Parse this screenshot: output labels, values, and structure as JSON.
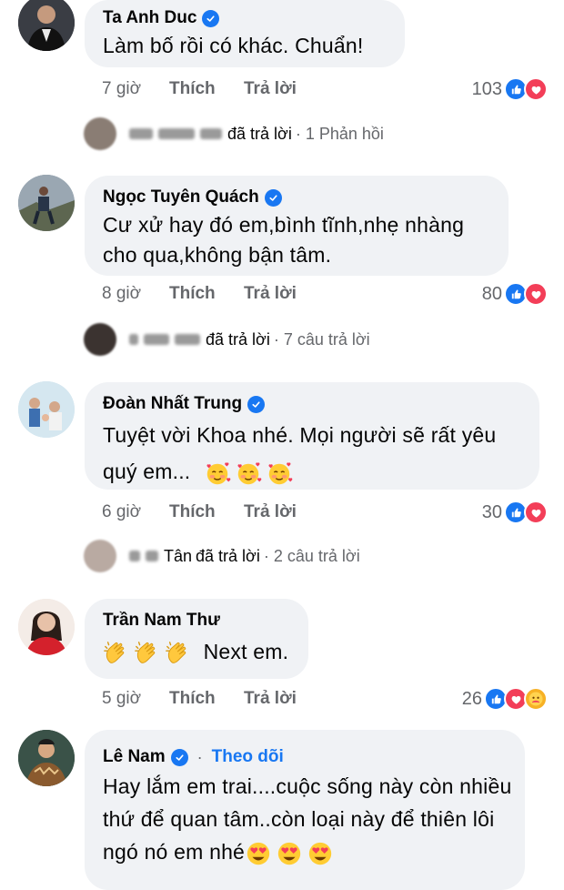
{
  "comments": [
    {
      "name": "Ta Anh Duc",
      "text": "Làm bố rồi có khác. Chuẩn!",
      "time": "7 giờ",
      "like": "Thích",
      "reply": "Trả lời",
      "count": "103",
      "replies": {
        "action": "đã trả lời",
        "summary": "· 1 Phản hồi"
      }
    },
    {
      "name": "Ngọc Tuyên Quách",
      "text": "Cư xử hay đó em,bình tĩnh,nhẹ nhàng cho qua,không bận tâm.",
      "time": "8 giờ",
      "like": "Thích",
      "reply": "Trả lời",
      "count": "80",
      "replies": {
        "action": "đã trả lời",
        "summary": "· 7 câu trả lời"
      }
    },
    {
      "name": "Đoàn Nhất Trung",
      "text": "Tuyệt vời Khoa nhé. Mọi người sẽ rất yêu quý em...",
      "time": "6 giờ",
      "like": "Thích",
      "reply": "Trả lời",
      "count": "30",
      "replies": {
        "name_fragment": "Tân",
        "action": "đã trả lời",
        "summary": "· 2 câu trả lời"
      }
    },
    {
      "name": "Trần Nam Thư",
      "text": "Next em.",
      "time": "5 giờ",
      "like": "Thích",
      "reply": "Trả lời",
      "count": "26"
    },
    {
      "name": "Lê Nam",
      "follow_sep": "·",
      "follow": "Theo dõi",
      "text": "Hay lắm em trai....cuộc sống này còn nhiều thứ để quan tâm..còn loại này để thiên lôi ngó nó em nhé"
    }
  ],
  "icons": {
    "like": "thumbs-up-icon",
    "love": "heart-icon",
    "care": "care-hug-icon",
    "verified": "verified-badge-icon",
    "emoji_hearts": "smiling-face-with-hearts-icon",
    "emoji_clap": "clapping-hands-icon",
    "emoji_heart_eyes": "heart-eyes-icon"
  },
  "colors": {
    "accent": "#1877f2",
    "love": "#f33e58",
    "bubble": "#f0f2f5",
    "muted": "#65676b"
  }
}
